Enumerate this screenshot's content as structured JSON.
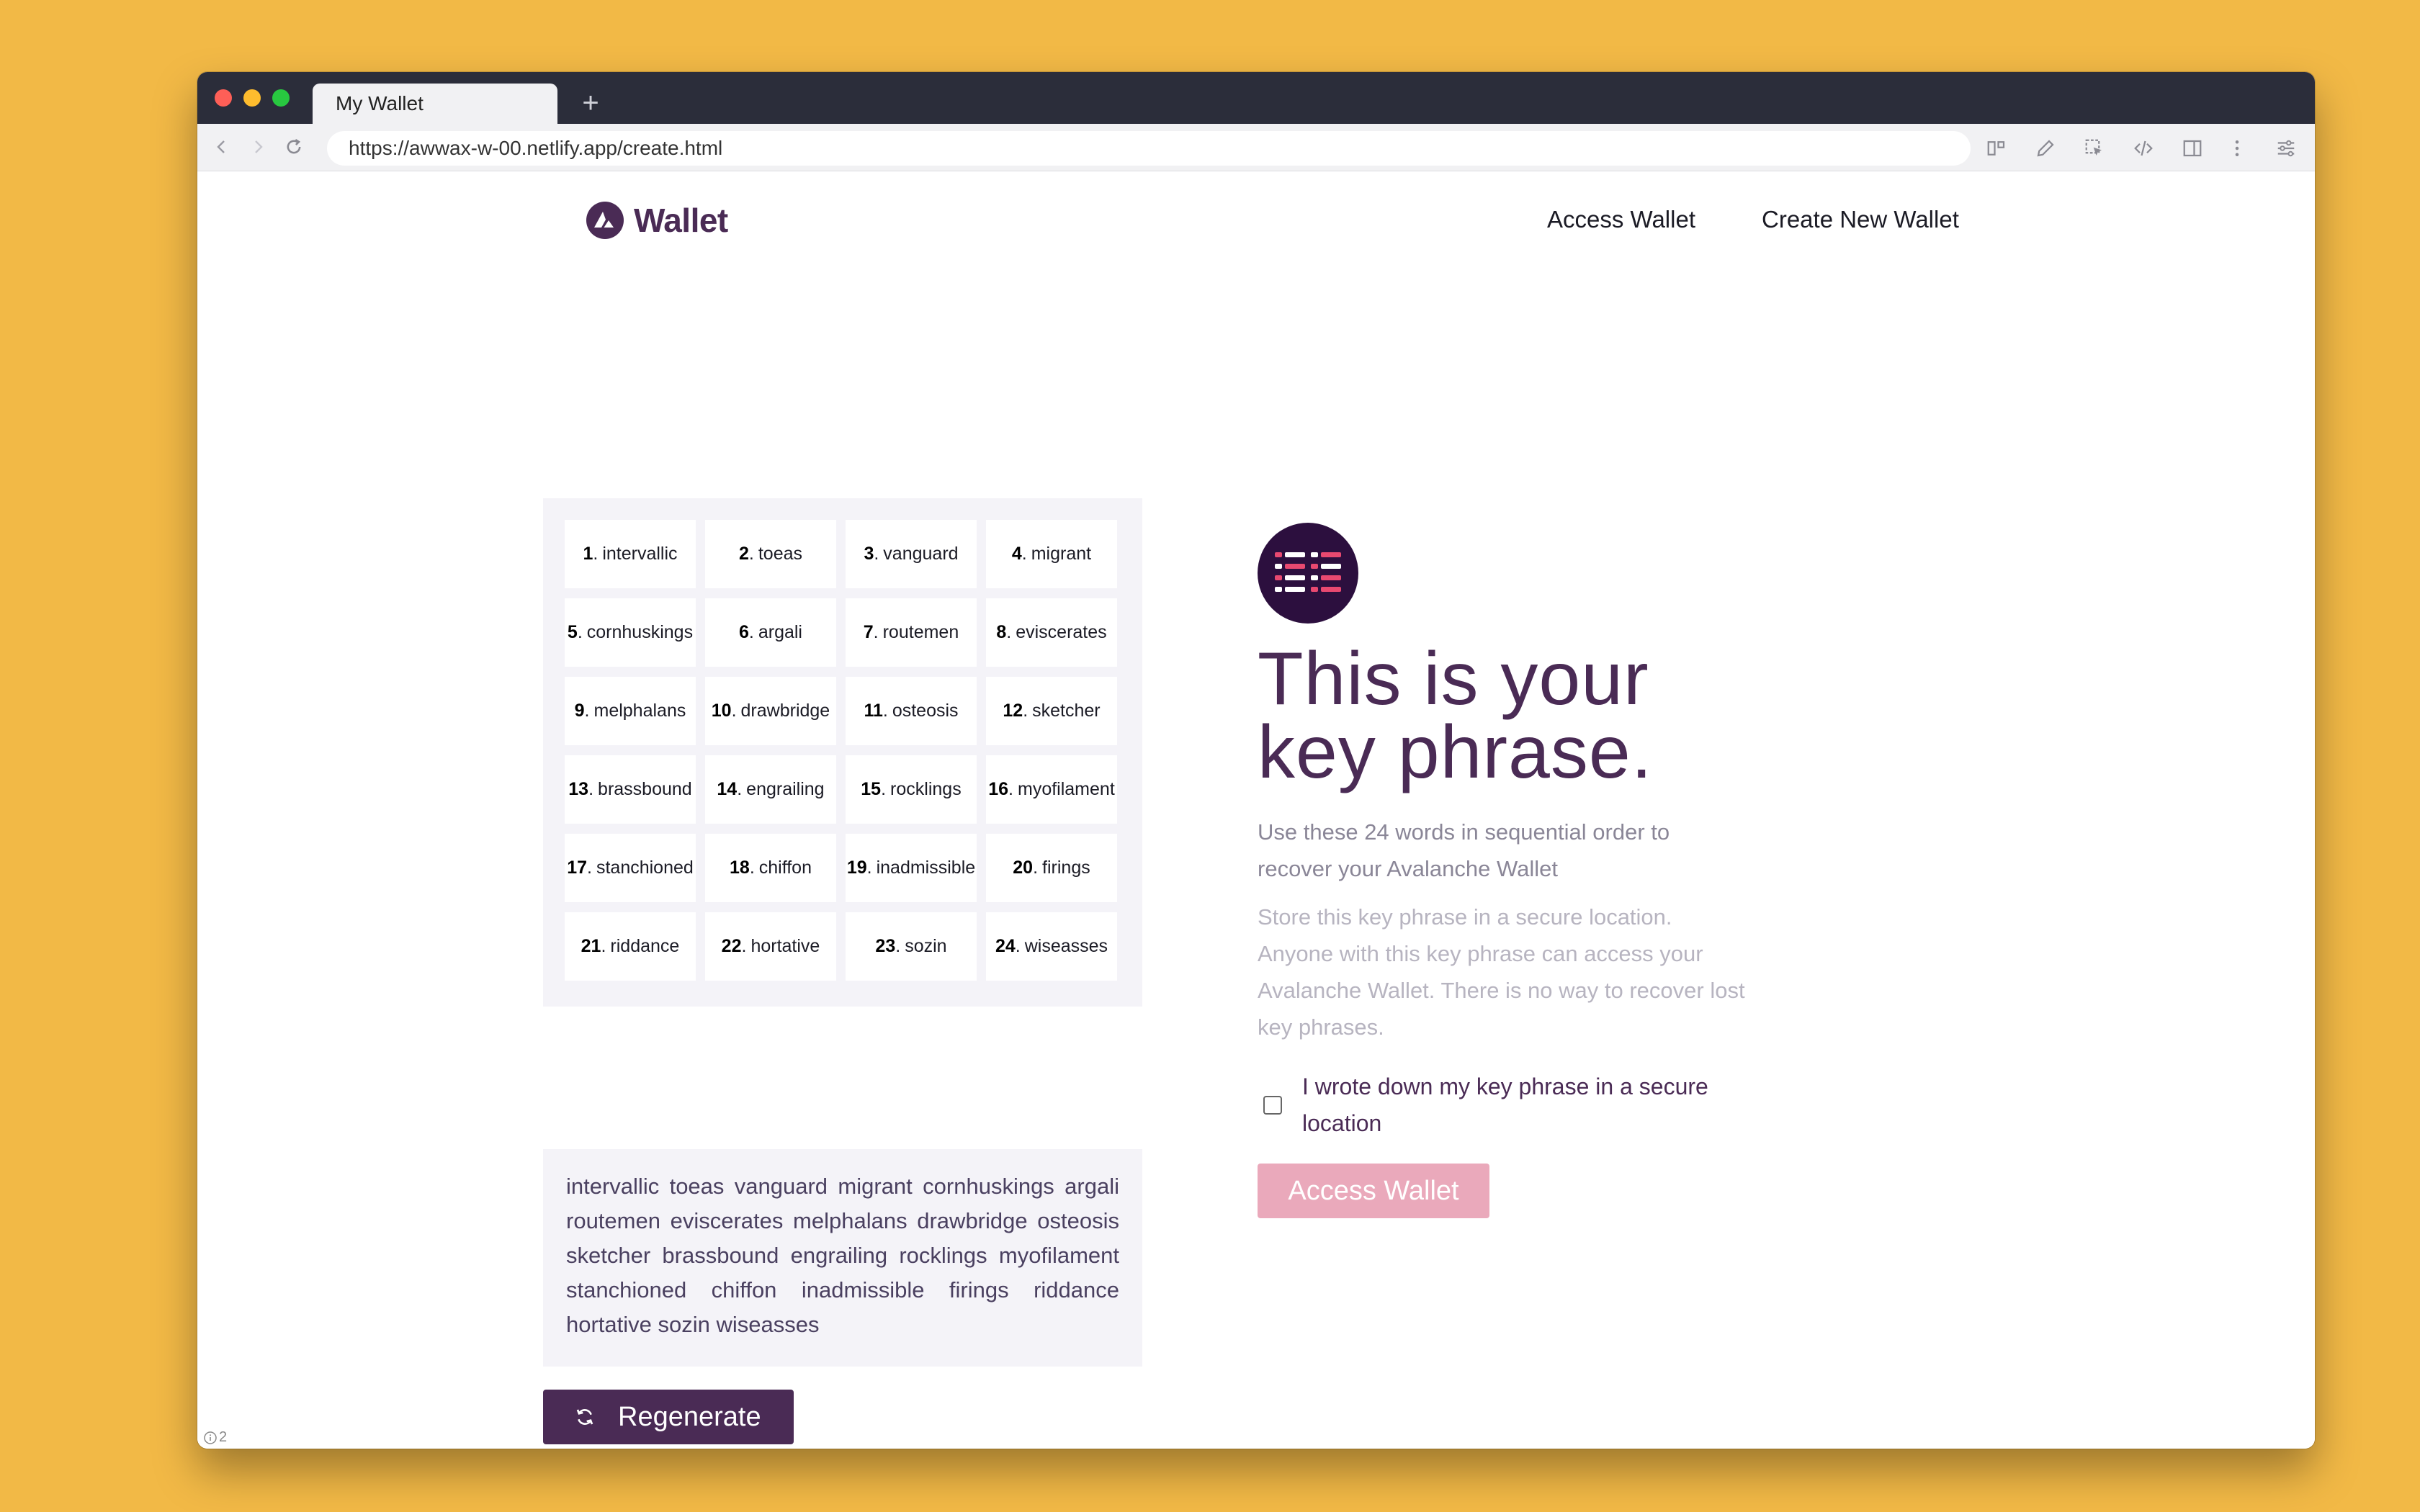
{
  "browser": {
    "tab_title": "My Wallet",
    "new_tab": "+",
    "url": "https://awwax-w-00.netlify.app/create.html",
    "status_count": "2"
  },
  "nav": {
    "brand": "Wallet",
    "links": [
      "Access Wallet",
      "Create New Wallet"
    ]
  },
  "mnemonic": {
    "words": [
      {
        "num": "1",
        "sep": ".",
        "word": "intervallic"
      },
      {
        "num": "2",
        "sep": ".",
        "word": "toeas"
      },
      {
        "num": "3",
        "sep": ".",
        "word": "vanguard"
      },
      {
        "num": "4",
        "sep": ".",
        "word": "migrant"
      },
      {
        "num": "5",
        "sep": ".",
        "word": "cornhuskings"
      },
      {
        "num": "6",
        "sep": ".",
        "word": "argali"
      },
      {
        "num": "7",
        "sep": ".",
        "word": "routemen"
      },
      {
        "num": "8",
        "sep": ".",
        "word": "eviscerates"
      },
      {
        "num": "9",
        "sep": ".",
        "word": "melphalans"
      },
      {
        "num": "10",
        "sep": ".",
        "word": "drawbridge"
      },
      {
        "num": "11",
        "sep": ".",
        "word": "osteosis"
      },
      {
        "num": "12",
        "sep": ".",
        "word": "sketcher"
      },
      {
        "num": "13",
        "sep": ".",
        "word": "brassbound"
      },
      {
        "num": "14",
        "sep": ".",
        "word": "engrailing"
      },
      {
        "num": "15",
        "sep": ".",
        "word": "rocklings"
      },
      {
        "num": "16",
        "sep": ".",
        "word": "myofilament"
      },
      {
        "num": "17",
        "sep": ".",
        "word": "stanchioned"
      },
      {
        "num": "18",
        "sep": ".",
        "word": "chiffon"
      },
      {
        "num": "19",
        "sep": ".",
        "word": "inadmissible"
      },
      {
        "num": "20",
        "sep": ".",
        "word": "firings"
      },
      {
        "num": "21",
        "sep": ".",
        "word": "riddance"
      },
      {
        "num": "22",
        "sep": ".",
        "word": "hortative"
      },
      {
        "num": "23",
        "sep": ".",
        "word": "sozin"
      },
      {
        "num": "24",
        "sep": ".",
        "word": "wiseasses"
      }
    ],
    "phrase": "intervallic toeas vanguard migrant cornhuskings argali routemen eviscerates melphalans drawbridge osteosis sketcher brassbound engrailing rocklings myofilament stanchioned chiffon inadmissible firings riddance hortative sozin wiseasses",
    "regenerate_label": "Regenerate"
  },
  "info": {
    "heading_line1": "This is your",
    "heading_line2": "key phrase.",
    "subtitle": "Use these 24 words in sequential order to recover your Avalanche Wallet",
    "warning": "Store this key phrase in a secure location. Anyone with this key phrase can access your Avalanche Wallet. There is no way to recover lost key phrases.",
    "confirm_label": "I wrote down my key phrase in a secure location",
    "confirm_checked": false,
    "access_label": "Access Wallet"
  },
  "colors": {
    "brand": "#4a2b55",
    "button_disabled": "#eaa9bb",
    "desktop": "#f2b946",
    "badge_bg": "#2c0f3e",
    "badge_accent": "#e84970"
  }
}
